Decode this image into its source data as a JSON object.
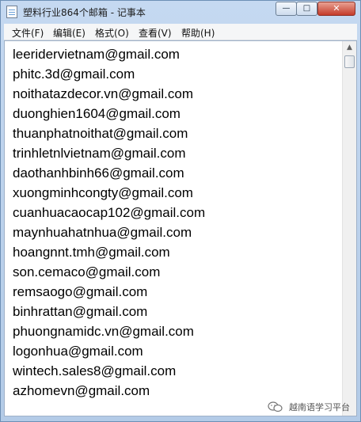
{
  "window": {
    "title": "塑料行业864个邮箱 - 记事本",
    "minimize_glyph": "—",
    "maximize_glyph": "□",
    "close_glyph": "✕",
    "icon": "notepad-icon"
  },
  "menu": [
    {
      "label": "文件(F)"
    },
    {
      "label": "编辑(E)"
    },
    {
      "label": "格式(O)"
    },
    {
      "label": "查看(V)"
    },
    {
      "label": "帮助(H)"
    }
  ],
  "content": {
    "lines": [
      "leeridervietnam@gmail.com",
      "phitc.3d@gmail.com",
      "noithatazdecor.vn@gmail.com",
      "duonghien1604@gmail.com",
      "thuanphatnoithat@gmail.com",
      "trinhletnlvietnam@gmail.com",
      "daothanhbinh66@gmail.com",
      "xuongminhcongty@gmail.com",
      "cuanhuacaocap102@gmail.com",
      "maynhuahatnhua@gmail.com",
      "hoangnnt.tmh@gmail.com",
      "son.cemaco@gmail.com",
      "remsaogo@gmail.com",
      "binhrattan@gmail.com",
      "phuongnamidc.vn@gmail.com",
      "logonhua@gmail.com",
      "wintech.sales8@gmail.com",
      "azhomevn@gmail.com"
    ]
  },
  "scrollbar": {
    "up_glyph": "▲"
  },
  "watermark": {
    "text": "越南语学习平台",
    "icon": "wechat-icon"
  }
}
